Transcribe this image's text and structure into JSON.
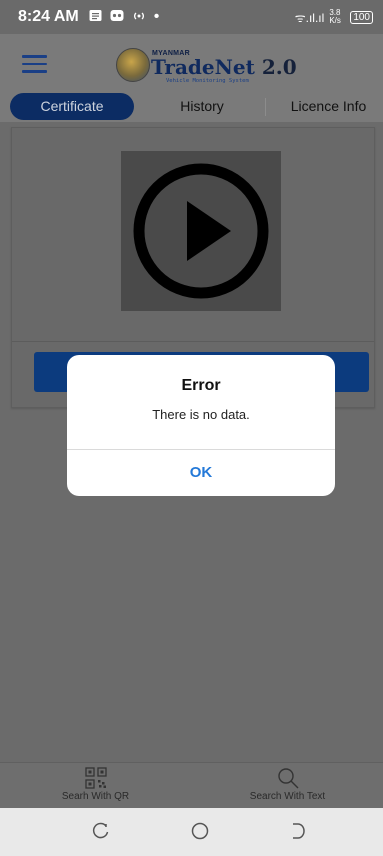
{
  "status_bar": {
    "time": "8:24 AM",
    "notification_icons": [
      "news-icon",
      "game-controller-icon",
      "hotspot-icon"
    ],
    "dot": "•",
    "signal_text": "ᯤ.ıl.ıl",
    "speed": "3.8 K/s",
    "battery": "100"
  },
  "app_bar": {
    "brand_top": "MYANMAR",
    "brand_name": "TradeNet",
    "brand_version": "2.0",
    "brand_subtitle": "Vehicle Monitoring System"
  },
  "tabs": [
    {
      "label": "Certificate",
      "active": true
    },
    {
      "label": "History",
      "active": false
    },
    {
      "label": "Licence Info",
      "active": false
    }
  ],
  "bottom_nav": [
    {
      "label": "Searh With QR",
      "icon": "qr-code-icon"
    },
    {
      "label": "Search With Text",
      "icon": "search-icon"
    }
  ],
  "dialog": {
    "title": "Error",
    "message": "There is no data.",
    "ok_label": "OK"
  },
  "colors": {
    "accent_blue": "#2479d8",
    "navy": "#0c2c63"
  }
}
